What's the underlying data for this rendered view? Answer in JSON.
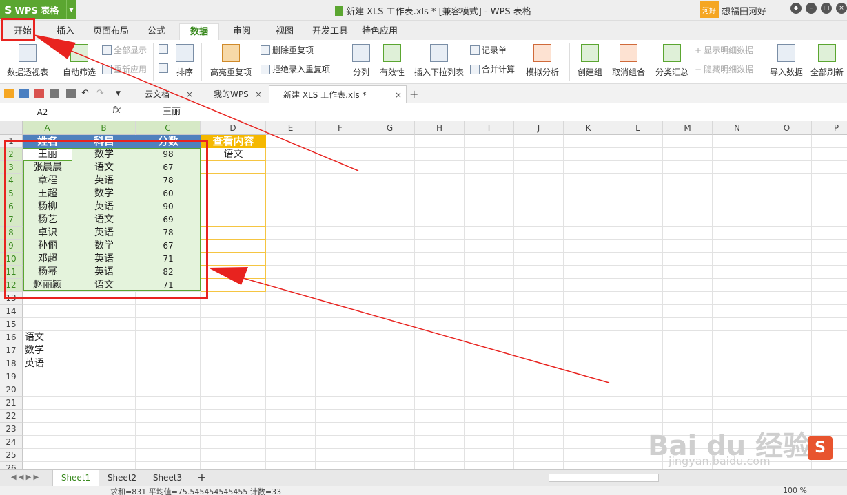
{
  "titlebar": {
    "app_name": "WPS 表格",
    "window_title": "新建 XLS 工作表.xls * [兼容模式] - WPS 表格",
    "user_badge": "河好",
    "user_name": "想福田河好"
  },
  "menu": {
    "tabs": [
      "开始",
      "插入",
      "页面布局",
      "公式",
      "数据",
      "审阅",
      "视图",
      "开发工具",
      "特色应用"
    ],
    "active": "数据"
  },
  "ribbon": {
    "pivot": "数据透视表",
    "autofilter": "自动筛选",
    "show_all": "全部显示",
    "reapply": "重新应用",
    "sort": "排序",
    "highlight_dup": "高亮重复项",
    "remove_dup": "删除重复项",
    "reject_dup": "拒绝录入重复项",
    "split": "分列",
    "validity": "有效性",
    "dropdown_list": "插入下拉列表",
    "records": "记录单",
    "merge_calc": "合并计算",
    "simulate": "模拟分析",
    "create_group": "创建组",
    "ungroup": "取消组合",
    "subtotal": "分类汇总",
    "show_detail": "显示明细数据",
    "hide_detail": "隐藏明细数据",
    "import": "导入数据",
    "refresh_all": "全部刷新"
  },
  "docbar": {
    "tabs": [
      "云文档",
      "我的WPS",
      "新建 XLS 工作表.xls *"
    ],
    "close": "×",
    "add": "+"
  },
  "formula": {
    "namebox": "A2",
    "fx": "fx",
    "value": "王丽"
  },
  "grid": {
    "columns": [
      "A",
      "B",
      "C",
      "D",
      "E",
      "F",
      "G",
      "H",
      "I",
      "J",
      "K",
      "L",
      "M",
      "N",
      "O",
      "P"
    ],
    "rows": [
      "1",
      "2",
      "3",
      "4",
      "5",
      "6",
      "7",
      "8",
      "9",
      "10",
      "11",
      "12",
      "13",
      "14",
      "15",
      "16",
      "17",
      "18",
      "19",
      "20",
      "21",
      "22",
      "23",
      "24",
      "25",
      "26"
    ],
    "headers": [
      "姓名",
      "科目",
      "分数"
    ],
    "lookup_header": "查看内容",
    "lookup_value": "语文",
    "records": [
      [
        "王丽",
        "数学",
        "98"
      ],
      [
        "张晨晨",
        "语文",
        "67"
      ],
      [
        "章程",
        "英语",
        "78"
      ],
      [
        "王超",
        "数学",
        "60"
      ],
      [
        "杨柳",
        "英语",
        "90"
      ],
      [
        "杨艺",
        "语文",
        "69"
      ],
      [
        "卓识",
        "英语",
        "78"
      ],
      [
        "孙俪",
        "数学",
        "67"
      ],
      [
        "邓超",
        "英语",
        "71"
      ],
      [
        "杨幂",
        "英语",
        "82"
      ],
      [
        "赵丽颖",
        "语文",
        "71"
      ]
    ],
    "subject_list": [
      "语文",
      "数学",
      "英语"
    ]
  },
  "sheets": {
    "tabs": [
      "Sheet1",
      "Sheet2",
      "Sheet3"
    ],
    "add": "+"
  },
  "status": {
    "text": "求和=831  平均值=75.545454545455  计数=33",
    "zoom": "100 %"
  },
  "watermark": {
    "brand": "Bai du 经验",
    "url": "jingyan.baidu.com",
    "ime": "S"
  }
}
